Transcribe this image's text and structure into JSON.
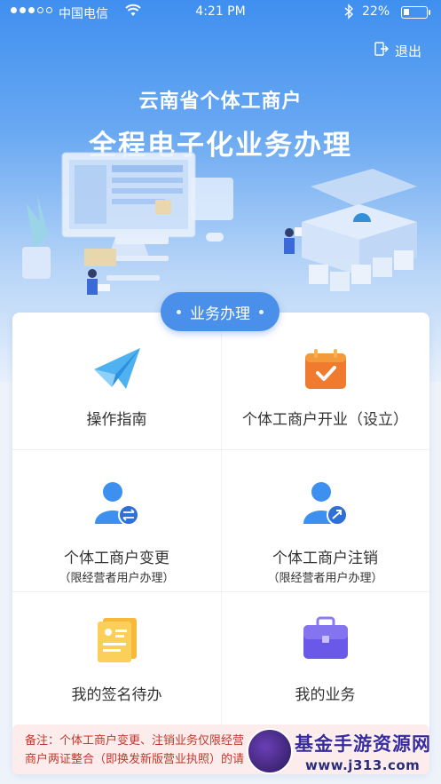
{
  "status_bar": {
    "carrier": "中国电信",
    "time": "4:21 PM",
    "battery": "22%",
    "signal_icon": "signal-dots-icon",
    "wifi_icon": "wifi-icon",
    "bluetooth_icon": "bluetooth-icon",
    "battery_icon": "battery-icon"
  },
  "header": {
    "logout_label": "退出",
    "logout_icon": "logout-icon",
    "title_line1": "云南省个体工商户",
    "title_line2": "全程电子化业务办理"
  },
  "section": {
    "title": "业务办理"
  },
  "tiles": [
    {
      "label": "操作指南",
      "sub": "",
      "icon": "paper-plane-icon"
    },
    {
      "label": "个体工商户开业（设立）",
      "sub": "",
      "icon": "calendar-check-icon"
    },
    {
      "label": "个体工商户变更",
      "sub": "（限经营者用户办理）",
      "icon": "user-change-icon"
    },
    {
      "label": "个体工商户注销",
      "sub": "（限经营者用户办理）",
      "icon": "user-cancel-icon"
    },
    {
      "label": "我的签名待办",
      "sub": "",
      "icon": "id-card-icon"
    },
    {
      "label": "我的业务",
      "sub": "",
      "icon": "briefcase-icon"
    }
  ],
  "note": {
    "line1": "备注：个体工商户变更、注销业务仅限经营",
    "line2": "商户两证整合（即换发新版营业执照）的请"
  },
  "watermark": {
    "title": "基金手游资源网",
    "url": "www.j313.com"
  },
  "colors": {
    "primary": "#4a90ea",
    "note_bg": "#fdecec",
    "note_text": "#c0392b"
  }
}
